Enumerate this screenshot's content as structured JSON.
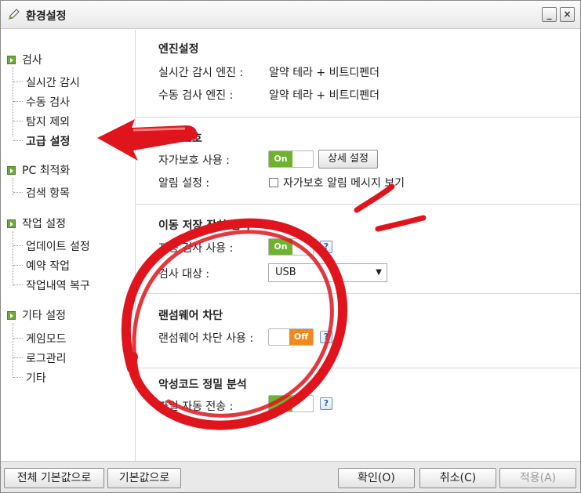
{
  "window": {
    "title": "환경설정",
    "minimize_label": "_",
    "close_label": "×",
    "title_icon": "pencil-icon"
  },
  "sidebar": {
    "groups": [
      {
        "title": "검사",
        "items": [
          "실시간 감시",
          "수동 검사",
          "탐지 제외",
          "고급 설정"
        ]
      },
      {
        "title": "PC 최적화",
        "items": [
          "검색 항목"
        ]
      },
      {
        "title": "작업 설정",
        "items": [
          "업데이트 설정",
          "예약 작업",
          "작업내역 복구"
        ]
      },
      {
        "title": "기타 설정",
        "items": [
          "게임모드",
          "로그관리",
          "기타"
        ]
      }
    ],
    "selected": "고급 설정"
  },
  "sections": {
    "engine": {
      "title": "엔진설정",
      "realtime_label": "실시간 감시 엔진 :",
      "realtime_value": "알약 테라 + 비트디펜더",
      "manual_label": "수동 검사 엔진 :",
      "manual_value": "알약 테라 + 비트디펜더"
    },
    "self_protect": {
      "title": "보호",
      "use_label": "자가보호 사용 :",
      "toggle_on": "On",
      "detail_button": "상세 설정",
      "alert_label": "알림 설정 :",
      "alert_checkbox": "자가보호 알림 메시지 보기"
    },
    "removable": {
      "title": "이동 저장 장치 검사",
      "auto_label": "자동 검사 사용 :",
      "toggle_on": "On",
      "target_label": "검사 대상 :",
      "target_value": "USB"
    },
    "ransomware": {
      "title": "랜섬웨어 차단",
      "use_label": "랜섬웨어 차단 사용 :",
      "toggle_off": "Off"
    },
    "malware": {
      "title": "악성코드 정밀 분석",
      "send_label": "파일 자동 전송 :"
    }
  },
  "help_label": "?",
  "bottom": {
    "reset_all": "전체 기본값으로",
    "reset": "기본값으로",
    "ok": "확인(O)",
    "cancel": "취소(C)",
    "apply": "적용(A)"
  },
  "colors": {
    "toggle_on": "#6fb22e",
    "toggle_off": "#f08a1c",
    "annotation_red": "#e0141c",
    "bullet_green": "#6ea83a"
  }
}
